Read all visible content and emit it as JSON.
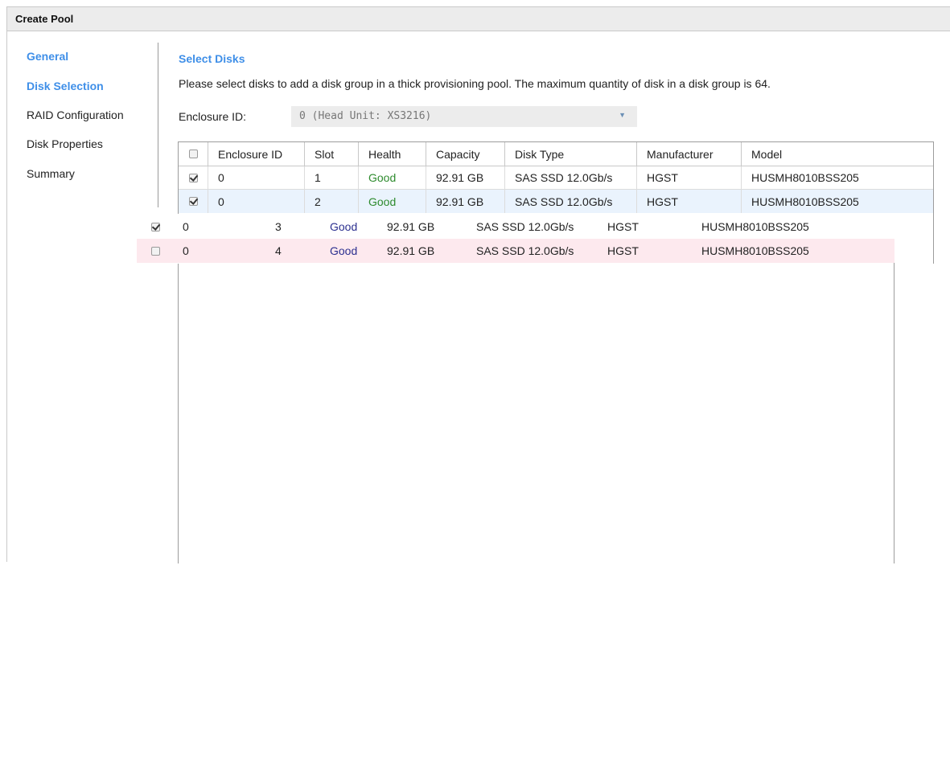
{
  "window": {
    "title": "Create Pool"
  },
  "nav": {
    "items": [
      {
        "label": "General",
        "active": true
      },
      {
        "label": "Disk Selection",
        "active": true
      },
      {
        "label": "RAID Configuration",
        "active": false
      },
      {
        "label": "Disk Properties",
        "active": false
      },
      {
        "label": "Summary",
        "active": false
      }
    ]
  },
  "main": {
    "section_title": "Select Disks",
    "description": "Please select disks to add a disk group in a thick provisioning pool. The maximum quantity of disk in a disk group is 64.",
    "enclosure": {
      "label": "Enclosure ID:",
      "selected": "0 (Head Unit: XS3216)"
    }
  },
  "table": {
    "headers": [
      "Enclosure ID",
      "Slot",
      "Health",
      "Capacity",
      "Disk Type",
      "Manufacturer",
      "Model"
    ],
    "header_checked": false,
    "rows": [
      {
        "checked": true,
        "enclosure_id": "0",
        "slot": "1",
        "health": "Good",
        "capacity": "92.91 GB",
        "disk_type": "SAS SSD 12.0Gb/s",
        "manufacturer": "HGST",
        "model": "HUSMH8010BSS205"
      },
      {
        "checked": true,
        "enclosure_id": "0",
        "slot": "2",
        "health": "Good",
        "capacity": "92.91 GB",
        "disk_type": "SAS SSD 12.0Gb/s",
        "manufacturer": "HGST",
        "model": "HUSMH8010BSS205"
      },
      {
        "checked": true,
        "enclosure_id": "0",
        "slot": "3",
        "health": "Good",
        "capacity": "92.91 GB",
        "disk_type": "SAS SSD 12.0Gb/s",
        "manufacturer": "HGST",
        "model": "HUSMH8010BSS205"
      },
      {
        "checked": false,
        "enclosure_id": "0",
        "slot": "4",
        "health": "Good",
        "capacity": "92.91 GB",
        "disk_type": "SAS SSD 12.0Gb/s",
        "manufacturer": "HGST",
        "model": "HUSMH8010BSS205"
      }
    ]
  },
  "colors": {
    "accent": "#3f8fe8",
    "health_good": "#2e8b2e",
    "selected_row": "#eaf3fd",
    "hover_row": "#fde9ee"
  }
}
